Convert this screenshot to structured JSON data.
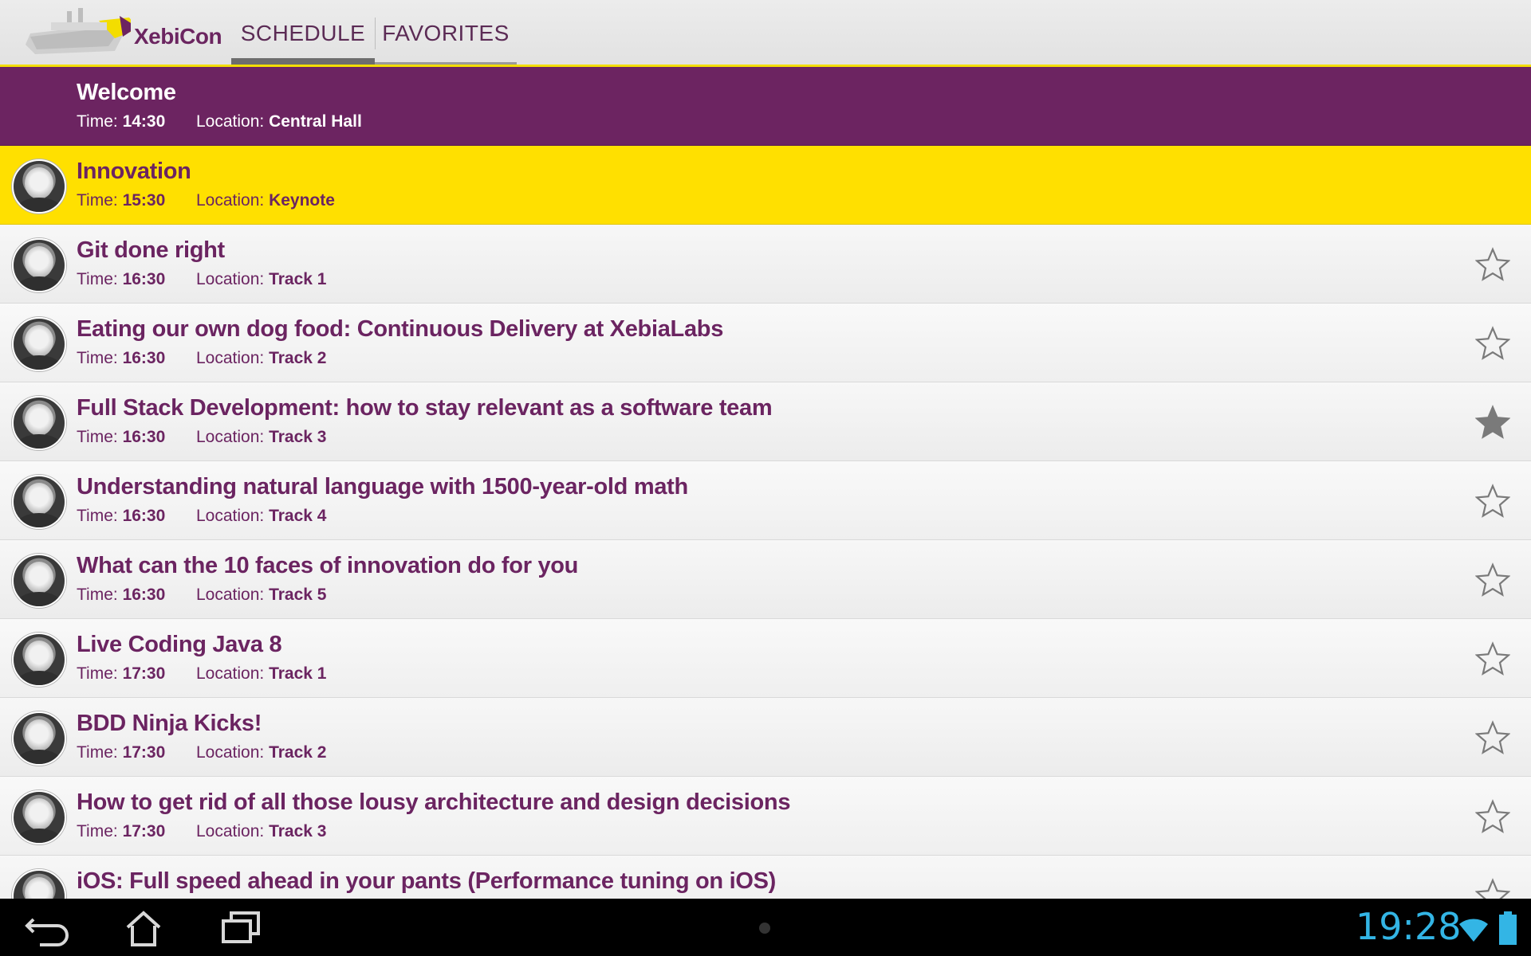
{
  "app": {
    "title": "XebiCon"
  },
  "tabs": [
    {
      "label": "SCHEDULE",
      "selected": true
    },
    {
      "label": "FAVORITES",
      "selected": false
    }
  ],
  "labels": {
    "time": "Time:",
    "location": "Location:"
  },
  "sessions": [
    {
      "title": "Welcome",
      "time": "14:30",
      "location": "Central Hall",
      "style": "welcome",
      "avatar": false,
      "favorite": null
    },
    {
      "title": "Innovation",
      "time": "15:30",
      "location": "Keynote",
      "style": "keynote",
      "avatar": true,
      "favorite": null
    },
    {
      "title": "Git done right",
      "time": "16:30",
      "location": "Track 1",
      "style": "normal",
      "avatar": true,
      "favorite": false
    },
    {
      "title": "Eating our own dog food: Continuous Delivery at XebiaLabs",
      "time": "16:30",
      "location": "Track 2",
      "style": "normal",
      "avatar": true,
      "favorite": false
    },
    {
      "title": "Full Stack Development: how to stay relevant as a software team",
      "time": "16:30",
      "location": "Track 3",
      "style": "normal",
      "avatar": true,
      "favorite": true
    },
    {
      "title": "Understanding natural language with 1500-year-old math",
      "time": "16:30",
      "location": "Track 4",
      "style": "normal",
      "avatar": true,
      "favorite": false
    },
    {
      "title": "What can the 10 faces of innovation do for you",
      "time": "16:30",
      "location": "Track 5",
      "style": "normal",
      "avatar": true,
      "favorite": false
    },
    {
      "title": "Live Coding Java 8",
      "time": "17:30",
      "location": "Track 1",
      "style": "normal",
      "avatar": true,
      "favorite": false
    },
    {
      "title": "BDD Ninja Kicks!",
      "time": "17:30",
      "location": "Track 2",
      "style": "normal",
      "avatar": true,
      "favorite": false
    },
    {
      "title": "How to get rid of all those lousy architecture and design decisions",
      "time": "17:30",
      "location": "Track 3",
      "style": "normal",
      "avatar": true,
      "favorite": false
    },
    {
      "title": "iOS: Full speed ahead in your pants (Performance tuning on iOS)",
      "time": "",
      "location": "",
      "style": "normal",
      "avatar": true,
      "favorite": false
    }
  ],
  "colors": {
    "brand_purple": "#6c2461",
    "brand_yellow": "#ffe000",
    "clock_blue": "#33b5e5",
    "star_filled": "#7a7a7a"
  },
  "status_bar": {
    "clock": "19:28"
  },
  "icons": {
    "back": "back-icon",
    "home": "home-icon",
    "recent": "recent-apps-icon",
    "wifi": "wifi-icon",
    "battery": "battery-icon",
    "star": "star-icon"
  }
}
